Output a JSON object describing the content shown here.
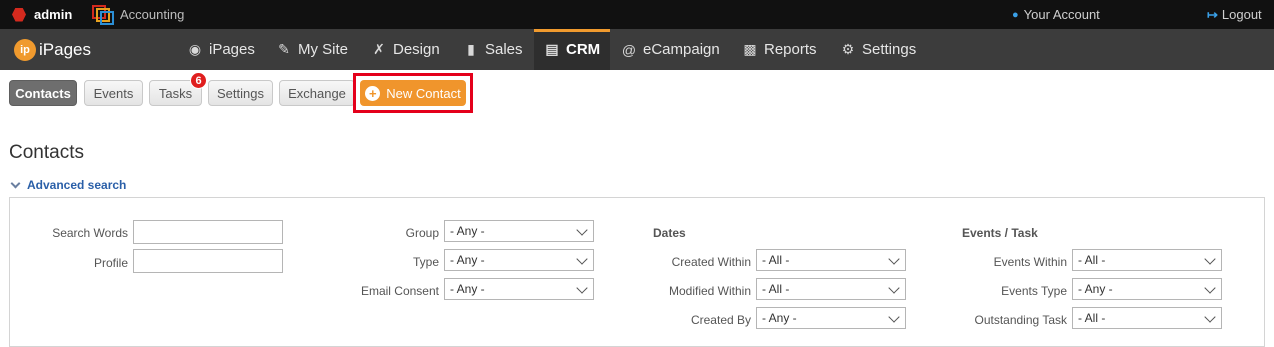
{
  "topbar": {
    "admin_label": "admin",
    "accounting_label": "Accounting",
    "your_account_label": "Your Account",
    "logout_label": "Logout"
  },
  "logo": {
    "badge": "ip",
    "text": "iPages"
  },
  "nav": {
    "items": [
      {
        "label": "iPages",
        "icon": "ipages-icon"
      },
      {
        "label": "My Site",
        "icon": "edit-page-icon"
      },
      {
        "label": "Design",
        "icon": "design-tools-icon"
      },
      {
        "label": "Sales",
        "icon": "sales-icon"
      },
      {
        "label": "CRM",
        "icon": "contacts-book-icon",
        "active": true
      },
      {
        "label": "eCampaign",
        "icon": "at-sign-icon"
      },
      {
        "label": "Reports",
        "icon": "bar-chart-icon"
      },
      {
        "label": "Settings",
        "icon": "gear-icon"
      }
    ]
  },
  "subnav": {
    "tabs": [
      {
        "label": "Contacts",
        "active": true
      },
      {
        "label": "Events"
      },
      {
        "label": "Tasks"
      },
      {
        "label": "Settings"
      },
      {
        "label": "Exchange"
      }
    ],
    "tasks_count": "6",
    "new_contact_label": "New Contact"
  },
  "page": {
    "title": "Contacts",
    "advanced_search_label": "Advanced search"
  },
  "search": {
    "col1": {
      "search_words_label": "Search Words",
      "search_words_value": "",
      "profile_label": "Profile",
      "profile_value": ""
    },
    "col2": {
      "group_label": "Group",
      "group_value": "- Any -",
      "type_label": "Type",
      "type_value": "- Any -",
      "email_consent_label": "Email Consent",
      "email_consent_value": "- Any -"
    },
    "col3": {
      "header": "Dates",
      "created_within_label": "Created Within",
      "created_within_value": "- All -",
      "modified_within_label": "Modified Within",
      "modified_within_value": "- All -",
      "created_by_label": "Created By",
      "created_by_value": "- Any -"
    },
    "col4": {
      "header": "Events / Task",
      "events_within_label": "Events Within",
      "events_within_value": "- All -",
      "events_type_label": "Events Type",
      "events_type_value": "- Any -",
      "outstanding_task_label": "Outstanding Task",
      "outstanding_task_value": "- All -"
    }
  },
  "colors": {
    "accent_orange": "#f0952c",
    "highlight_red": "#e4001b",
    "badge_red": "#e01f1f",
    "link_blue": "#2a5fa8"
  }
}
